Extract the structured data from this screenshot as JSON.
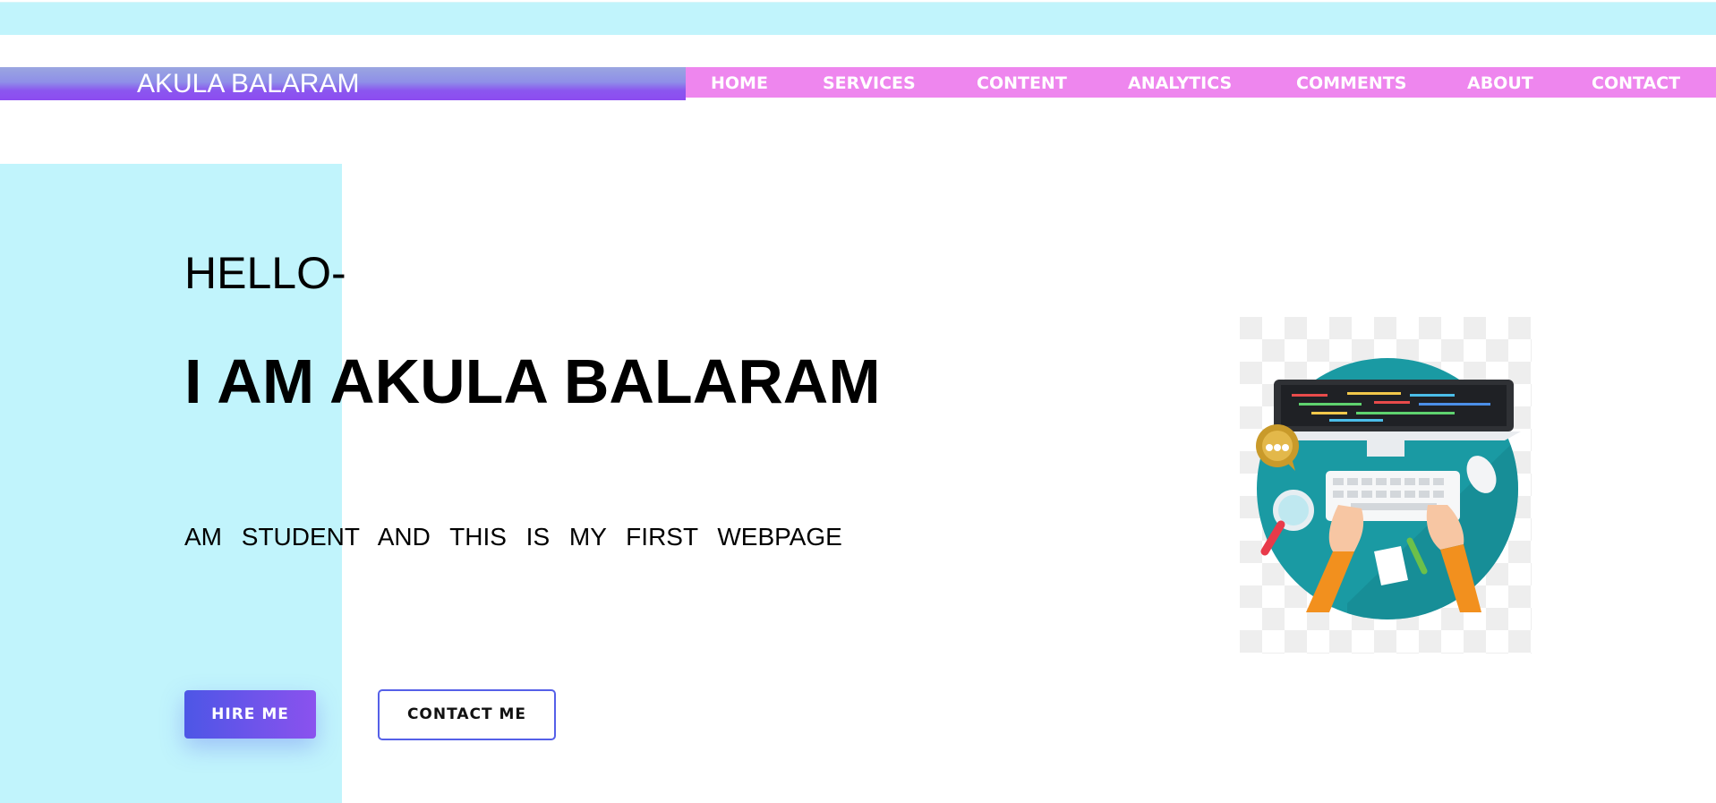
{
  "header": {
    "brand": "AKULA BALARAM",
    "nav": [
      "HOME",
      "SERVICES",
      "CONTENT",
      "ANALYTICS",
      "COMMENTS",
      "ABOUT",
      "CONTACT"
    ]
  },
  "hero": {
    "greeting": "HELLO-",
    "headline": "I AM AKULA BALARAM",
    "tagline": "AM STUDENT AND THIS IS MY FIRST WEBPAGE",
    "hire_button": "HIRE ME",
    "contact_button": "CONTACT ME"
  },
  "illustration": {
    "icon": "developer-desk-icon"
  },
  "colors": {
    "top_strip": "#c1f4fc",
    "nav_background": "#ee86ee",
    "brand_gradient_end": "#8c4cf0",
    "side_block": "#c1f4fc",
    "button_gradient_start": "#4d56e6",
    "button_gradient_end": "#8b52ee",
    "circle_teal": "#1a9aa3"
  }
}
